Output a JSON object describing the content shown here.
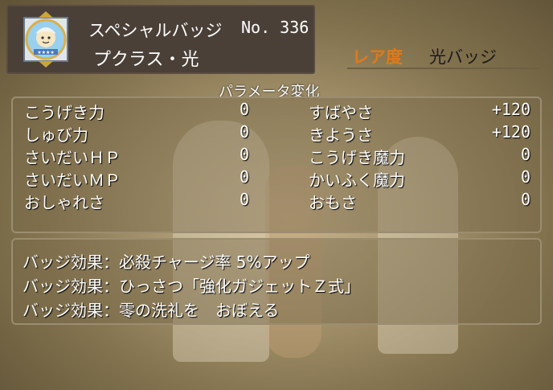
{
  "header": {
    "title": "スペシャルバッジ",
    "number": "No. 336",
    "name": "プクラス・光"
  },
  "rarity": {
    "label": "レア度",
    "value": "光バッジ"
  },
  "params": {
    "title": "パラメータ変化",
    "left": [
      {
        "label": "こうげき力",
        "value": "0"
      },
      {
        "label": "しゅび力",
        "value": "0"
      },
      {
        "label": "さいだいＨＰ",
        "value": "0"
      },
      {
        "label": "さいだいＭＰ",
        "value": "0"
      },
      {
        "label": "おしゃれさ",
        "value": "0"
      }
    ],
    "right": [
      {
        "label": "すばやさ",
        "value": "+120"
      },
      {
        "label": "きようさ",
        "value": "+120"
      },
      {
        "label": "こうげき魔力",
        "value": "0"
      },
      {
        "label": "かいふく魔力",
        "value": "0"
      },
      {
        "label": "おもさ",
        "value": "0"
      }
    ]
  },
  "effects": [
    "バッジ効果：必殺チャージ率 5%アップ",
    "バッジ効果：ひっさつ「強化ガジェットＺ式」",
    "バッジ効果：零の洗礼を　おぼえる"
  ],
  "colors": {
    "rarity_label": "#e07a1a",
    "panel": "#4a4038"
  },
  "icons": [
    "puklass-badge-icon"
  ]
}
